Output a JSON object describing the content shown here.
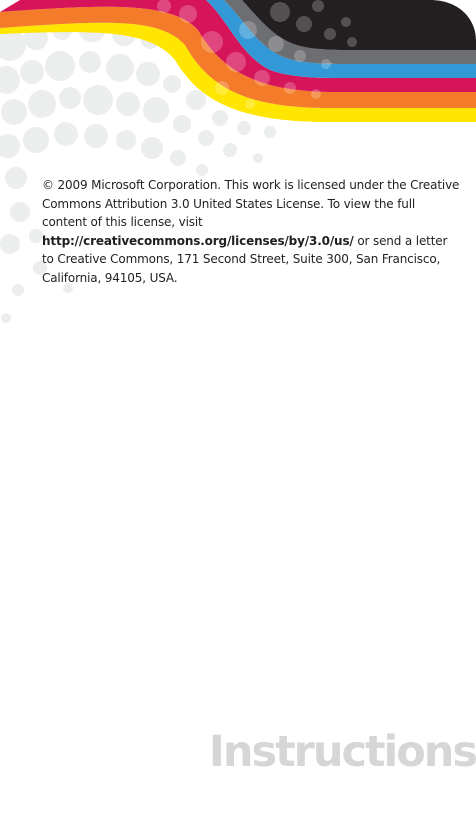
{
  "license": {
    "text_before": "© 2009 Microsoft Corporation. This work is licensed under the Creative Commons Attribution 3.0 United States License. To view the full content of this license, visit ",
    "url": "http://creativecommons.org/licenses/by/3.0/us/",
    "text_after": " or send a letter to Creative Commons, 171 Second Street, Suite 300, San Francisco, California, 94105, USA."
  },
  "footer": {
    "title": "Instructions"
  },
  "colors": {
    "band_yellow": "#ffe600",
    "band_orange": "#f47b2a",
    "band_red": "#d6145a",
    "band_blue": "#3399d6",
    "band_gray": "#6d6e71",
    "band_black": "#231f20",
    "dots": "#eceded",
    "text": "#231f20",
    "footer_text": "#d6d6d6"
  }
}
